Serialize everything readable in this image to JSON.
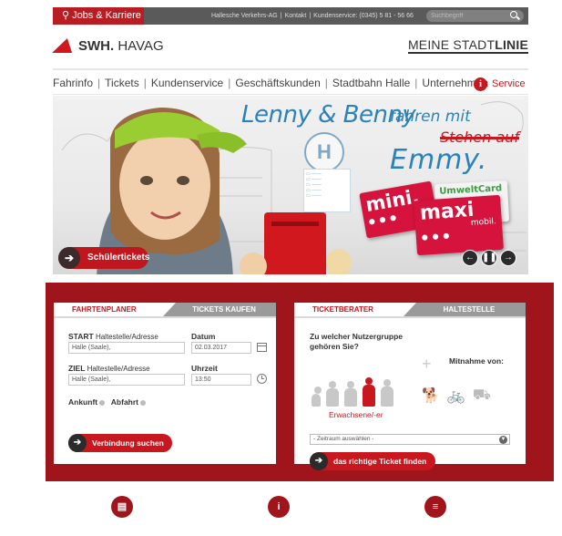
{
  "topbar": {
    "jobs_label": "Jobs & Karriere",
    "company": "Hallesche Verkehrs-AG",
    "kontakt": "Kontakt",
    "kundenservice": "Kundenservice: (0345) 5 81 - 56 66",
    "search_placeholder": "Suchbegriff"
  },
  "header": {
    "brand_bold": "SWH.",
    "brand_rest": "HAVAG",
    "stadtlinie_light": "MEINE STADT",
    "stadtlinie_bold": "LINIE"
  },
  "nav": {
    "items": [
      "Fahrinfo",
      "Tickets",
      "Kundenservice",
      "Geschäftskunden",
      "Stadtbahn Halle",
      "Unternehmen"
    ],
    "service_label": "Service"
  },
  "hero": {
    "headline": "Lenny & Benny",
    "headline_b": "fahren mit",
    "strike": "Stehen auf",
    "emmy": "Emmy.",
    "card_mini": "mini.",
    "card_umwelt": "UmweltCard",
    "card_maxi": "maxi",
    "card_maxi_small": "mobil.",
    "badge_label": "Schülertickets",
    "stop_letter": "H"
  },
  "fahrtenplaner": {
    "tab_active": "FAHRTENPLANER",
    "tab_inactive": "TICKETS KAUFEN",
    "start_label": "START",
    "start_hint": "Haltestelle/Adresse",
    "start_value": "Halle (Saale),",
    "ziel_label": "ZIEL",
    "ziel_hint": "Haltestelle/Adresse",
    "ziel_value": "Halle (Saale),",
    "datum_label": "Datum",
    "datum_value": "02.03.2017",
    "uhrzeit_label": "Uhrzeit",
    "uhrzeit_value": "13:50",
    "ankunft": "Ankunft",
    "abfahrt": "Abfahrt",
    "button": "Verbindung suchen"
  },
  "ticketberater": {
    "tab_active": "TICKETBERATER",
    "tab_inactive": "HALTESTELLE",
    "question": "Zu welcher Nutzergruppe gehören Sie?",
    "mitnahme": "Mitnahme von:",
    "selected_group": "Erwachsene/-er",
    "select_value": "- Zeitraum auswählen -",
    "button": "das richtige Ticket finden"
  },
  "colors": {
    "accent": "#c8171e",
    "panel": "#a0151b",
    "topbar": "#5a5a5a",
    "hero_text": "#2c82b8"
  }
}
